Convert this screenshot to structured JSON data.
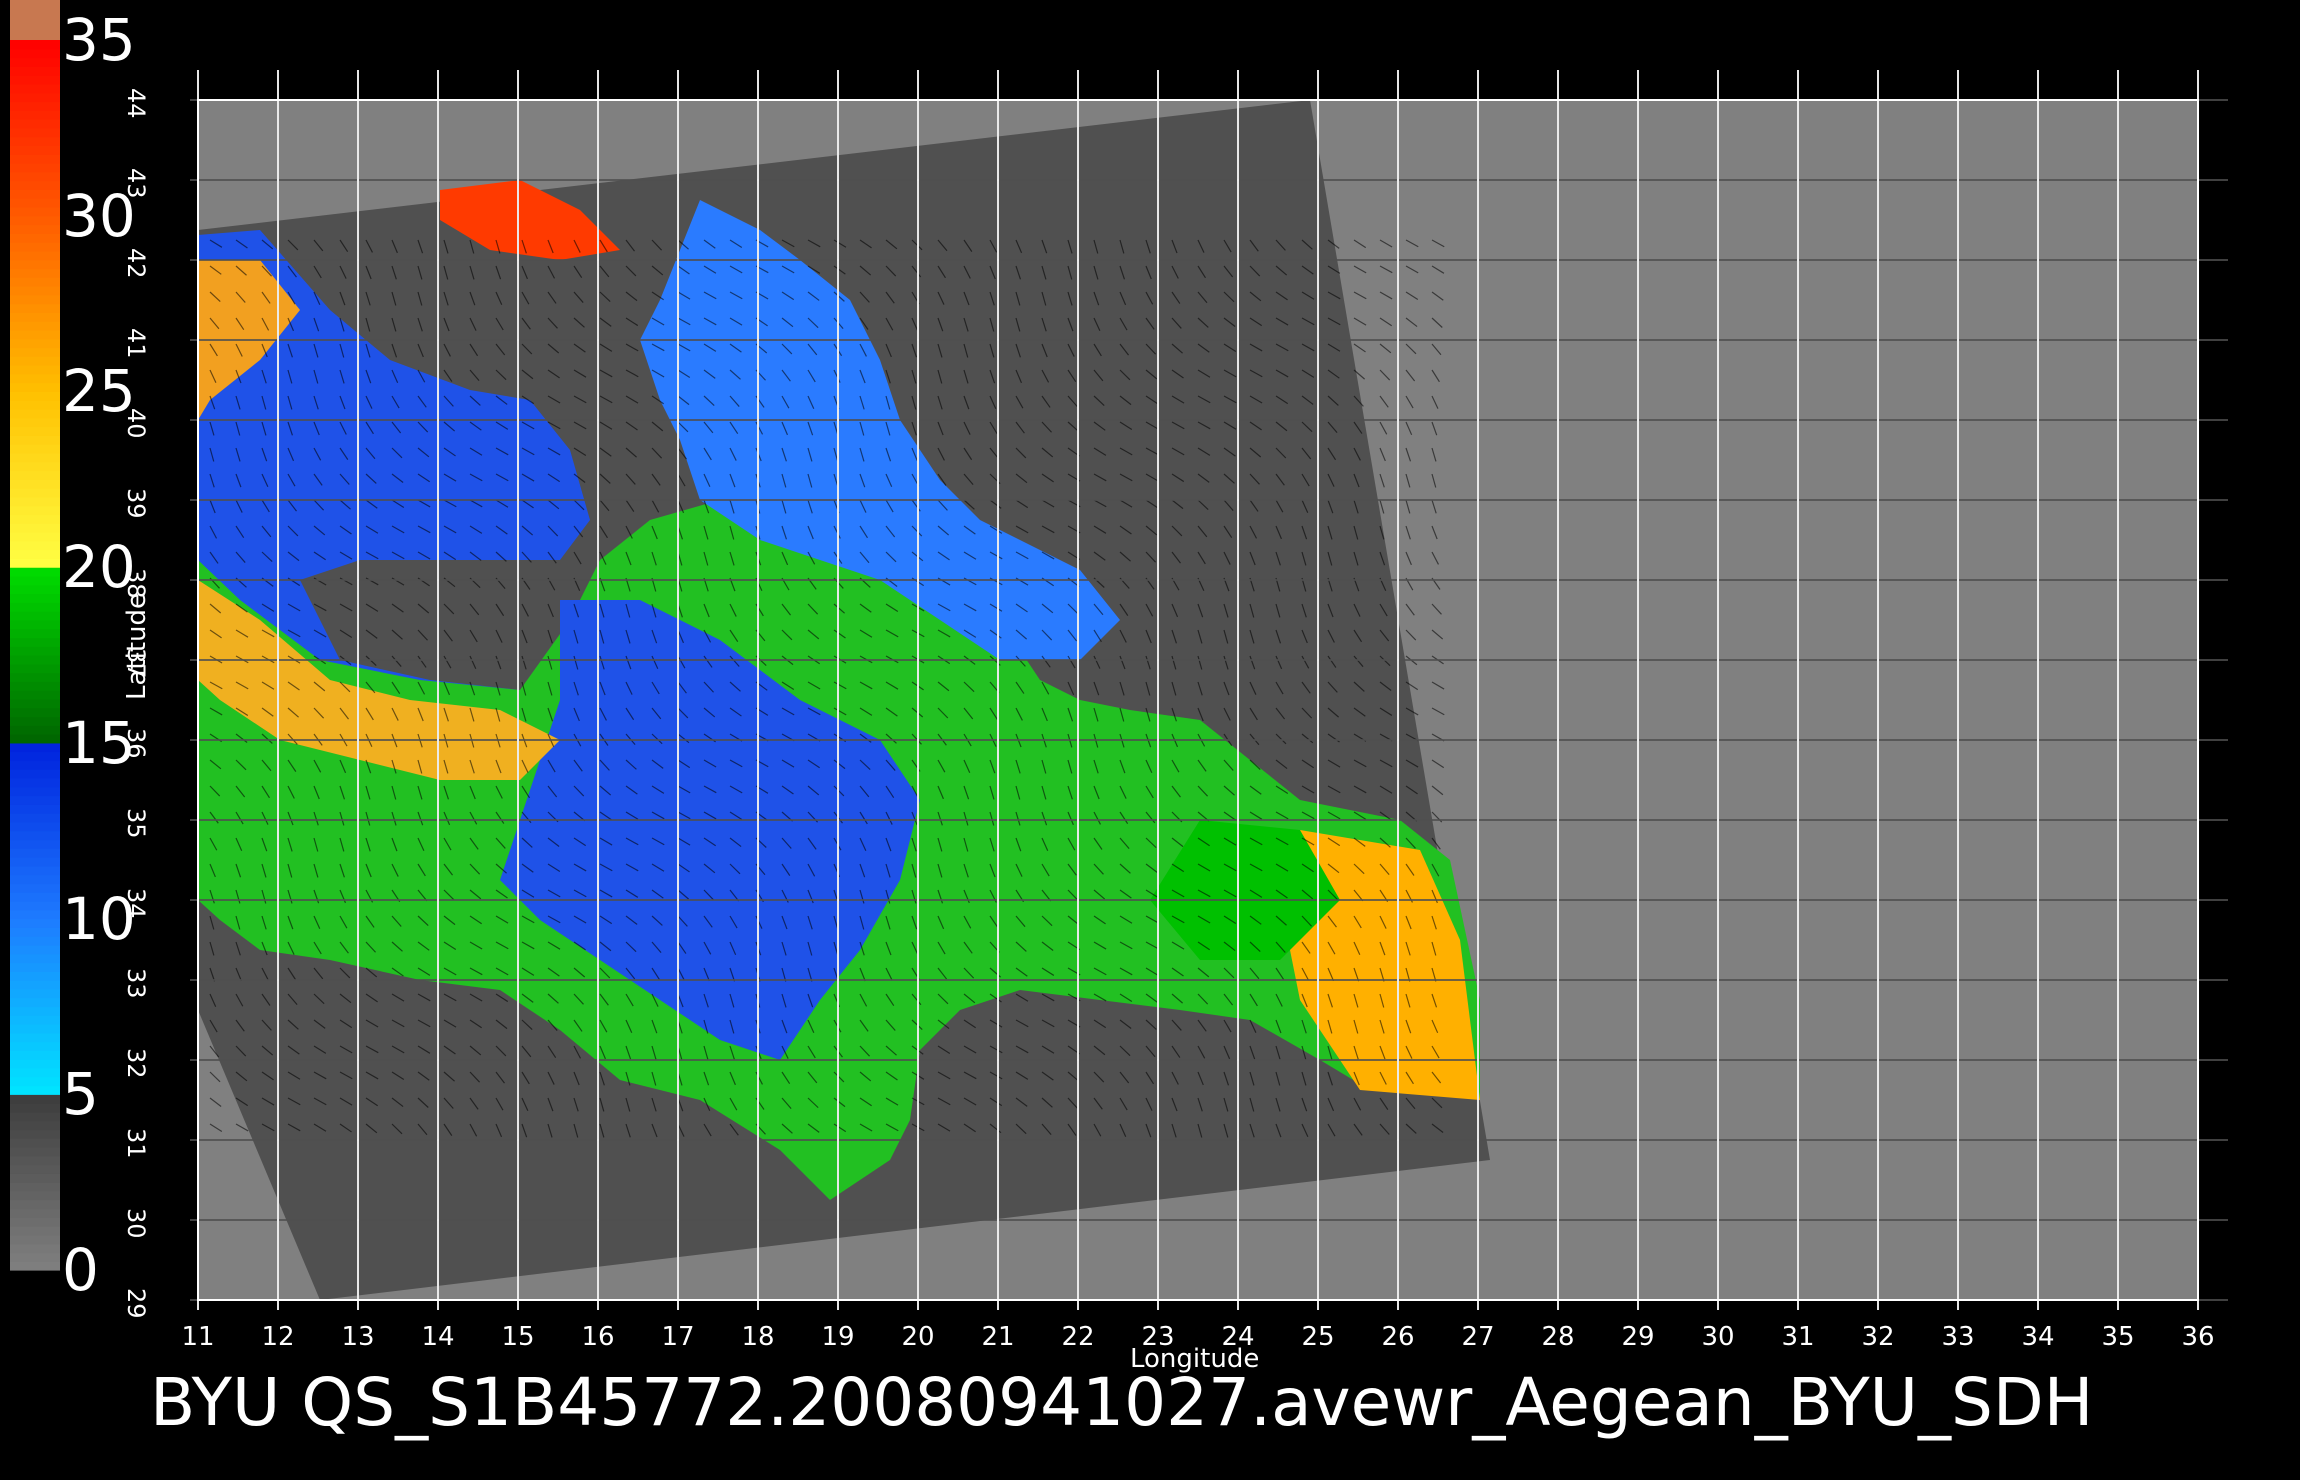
{
  "title": "BYU  QS_S1B45772.20080941027.avewr_Aegean_BYU_SDH",
  "colorbar": {
    "labels": [
      "0",
      "5",
      "10",
      "15",
      "20",
      "25",
      "30",
      "35"
    ],
    "stops": [
      {
        "v": 0,
        "color": "#808080"
      },
      {
        "v": 5,
        "color": "#3c3c3c"
      },
      {
        "v": 5.01,
        "color": "#00e5ff"
      },
      {
        "v": 10,
        "color": "#1e7bff"
      },
      {
        "v": 15,
        "color": "#0022dd"
      },
      {
        "v": 15.01,
        "color": "#006400"
      },
      {
        "v": 20,
        "color": "#00dd00"
      },
      {
        "v": 20.01,
        "color": "#ffff44"
      },
      {
        "v": 25,
        "color": "#ffc000"
      },
      {
        "v": 30,
        "color": "#ff5a00"
      },
      {
        "v": 35,
        "color": "#ff0000"
      },
      {
        "v": 35.01,
        "color": "#c87850"
      }
    ]
  },
  "map": {
    "xlabel": "Longitude",
    "ylabel": "Latitude",
    "lon_range": [
      11,
      36
    ],
    "lat_range": [
      29,
      44
    ],
    "lon_ticks": [
      "11",
      "12",
      "13",
      "14",
      "15",
      "16",
      "17",
      "18",
      "19",
      "20",
      "21",
      "22",
      "23",
      "24",
      "25",
      "26",
      "27",
      "28",
      "29",
      "30",
      "31",
      "32",
      "33",
      "34",
      "35",
      "36"
    ],
    "lat_ticks": [
      "29",
      "30",
      "31",
      "32",
      "33",
      "34",
      "35",
      "36",
      "37",
      "38",
      "39",
      "40",
      "41",
      "42",
      "43",
      "44"
    ],
    "colors": {
      "outside": "#808080",
      "land": "#505050",
      "grid": "#000000"
    }
  }
}
